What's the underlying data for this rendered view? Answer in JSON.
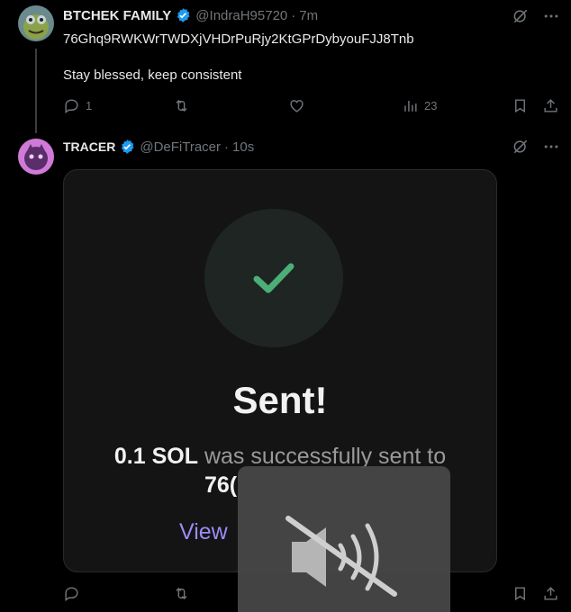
{
  "tweet1": {
    "display_name": "BTCHEK FAMILY",
    "handle": "@IndraH95720",
    "time": "7m",
    "text_line1": "76Ghq9RWKWrTWDXjVHDrPuRjy2KtGPrDybyouFJJ8Tnb",
    "text_line2": "Stay blessed, keep consistent",
    "reply_count": "1",
    "views_count": "23"
  },
  "tweet2": {
    "display_name": "TRACER",
    "handle": "@DeFiTracer",
    "time": "10s"
  },
  "card": {
    "title": "Sent!",
    "amount": "0.1 SOL",
    "desc_rest": "was successfully sent to",
    "addr_partial": "76(",
    "view_label": "View"
  },
  "colors": {
    "accent_check": "#4caf77",
    "verified_blue": "#1d9bf0",
    "link_purple": "#9a8cf5"
  },
  "icons": {
    "grok": "grok-icon",
    "more": "more-icon",
    "reply": "reply-icon",
    "retweet": "retweet-icon",
    "like": "like-icon",
    "views": "views-icon",
    "bookmark": "bookmark-icon",
    "share": "share-icon",
    "muted": "muted-speaker-icon",
    "check": "checkmark-icon"
  }
}
